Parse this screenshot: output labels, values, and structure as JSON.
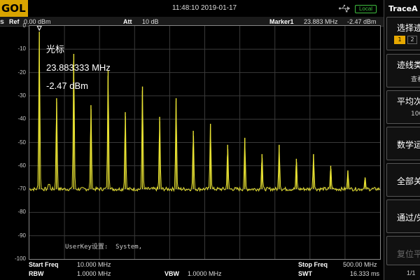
{
  "header": {
    "brand": "GOL",
    "datetime": "11:48:10 2019-01-17",
    "local_badge": "Local",
    "usb_icon": "usb-icon"
  },
  "status": {
    "ref_label": "Ref",
    "ref_value": "0.00 dBm",
    "att_label": "Att",
    "att_value": "10 dB",
    "marker_label": "Marker1",
    "marker_freq": "23.883 MHz",
    "marker_level": "-2.47 dBm"
  },
  "left_edge_text": "s",
  "plot": {
    "y_ticks": [
      "0",
      "-10",
      "-20",
      "-30",
      "-40",
      "-50",
      "-60",
      "-70",
      "-80",
      "-90",
      "-100"
    ],
    "marker_readout": {
      "title": "光标",
      "freq": "23.883333 MHz",
      "level": "-2.47 dBm"
    },
    "userkey_text": "UserKey设置:  System,"
  },
  "footer": {
    "start_label": "Start Freq",
    "start_value": "10.000 MHz",
    "stop_label": "Stop Freq",
    "stop_value": "500.00 MHz",
    "rbw_label": "RBW",
    "rbw_value": "1.0000 MHz",
    "vbw_label": "VBW",
    "vbw_value": "1.0000 MHz",
    "swt_label": "SWT",
    "swt_value": "16.333 ms"
  },
  "softkeys": {
    "title": "TraceA",
    "select_trace": "选择迹",
    "trace_btn_1": "1",
    "trace_btn_2": "2",
    "trace_type": "迹线类",
    "trace_type_sub": "查看",
    "avg_count": "平均次",
    "avg_count_sub": "100",
    "math": "数学运",
    "clear_all": "全部关",
    "pass_fail": "通过/失",
    "reset": "复位平",
    "page": "1/1"
  },
  "colors": {
    "trace": "#e8e233",
    "grid": "#3a3a3a",
    "brand": "#d9a400",
    "local": "#3fbf3f"
  },
  "chart_data": {
    "type": "line",
    "xlabel": "",
    "ylabel": "",
    "ylim": [
      -100,
      0
    ],
    "xlim_mhz": [
      10,
      500
    ],
    "grid": true,
    "noise_floor_dbm": -70,
    "peaks": [
      {
        "freq_mhz": 23.88,
        "level_dbm": -2.47
      },
      {
        "freq_mhz": 48,
        "level_dbm": -31
      },
      {
        "freq_mhz": 72,
        "level_dbm": -12
      },
      {
        "freq_mhz": 96,
        "level_dbm": -34
      },
      {
        "freq_mhz": 120,
        "level_dbm": -19
      },
      {
        "freq_mhz": 144,
        "level_dbm": -37
      },
      {
        "freq_mhz": 168,
        "level_dbm": -26
      },
      {
        "freq_mhz": 192,
        "level_dbm": -39
      },
      {
        "freq_mhz": 215,
        "level_dbm": -31
      },
      {
        "freq_mhz": 239,
        "level_dbm": -45
      },
      {
        "freq_mhz": 263,
        "level_dbm": -42
      },
      {
        "freq_mhz": 287,
        "level_dbm": -51
      },
      {
        "freq_mhz": 311,
        "level_dbm": -48
      },
      {
        "freq_mhz": 335,
        "level_dbm": -55
      },
      {
        "freq_mhz": 359,
        "level_dbm": -51
      },
      {
        "freq_mhz": 383,
        "level_dbm": -57
      },
      {
        "freq_mhz": 407,
        "level_dbm": -55
      },
      {
        "freq_mhz": 431,
        "level_dbm": -60
      },
      {
        "freq_mhz": 455,
        "level_dbm": -62
      },
      {
        "freq_mhz": 479,
        "level_dbm": -65
      }
    ]
  }
}
